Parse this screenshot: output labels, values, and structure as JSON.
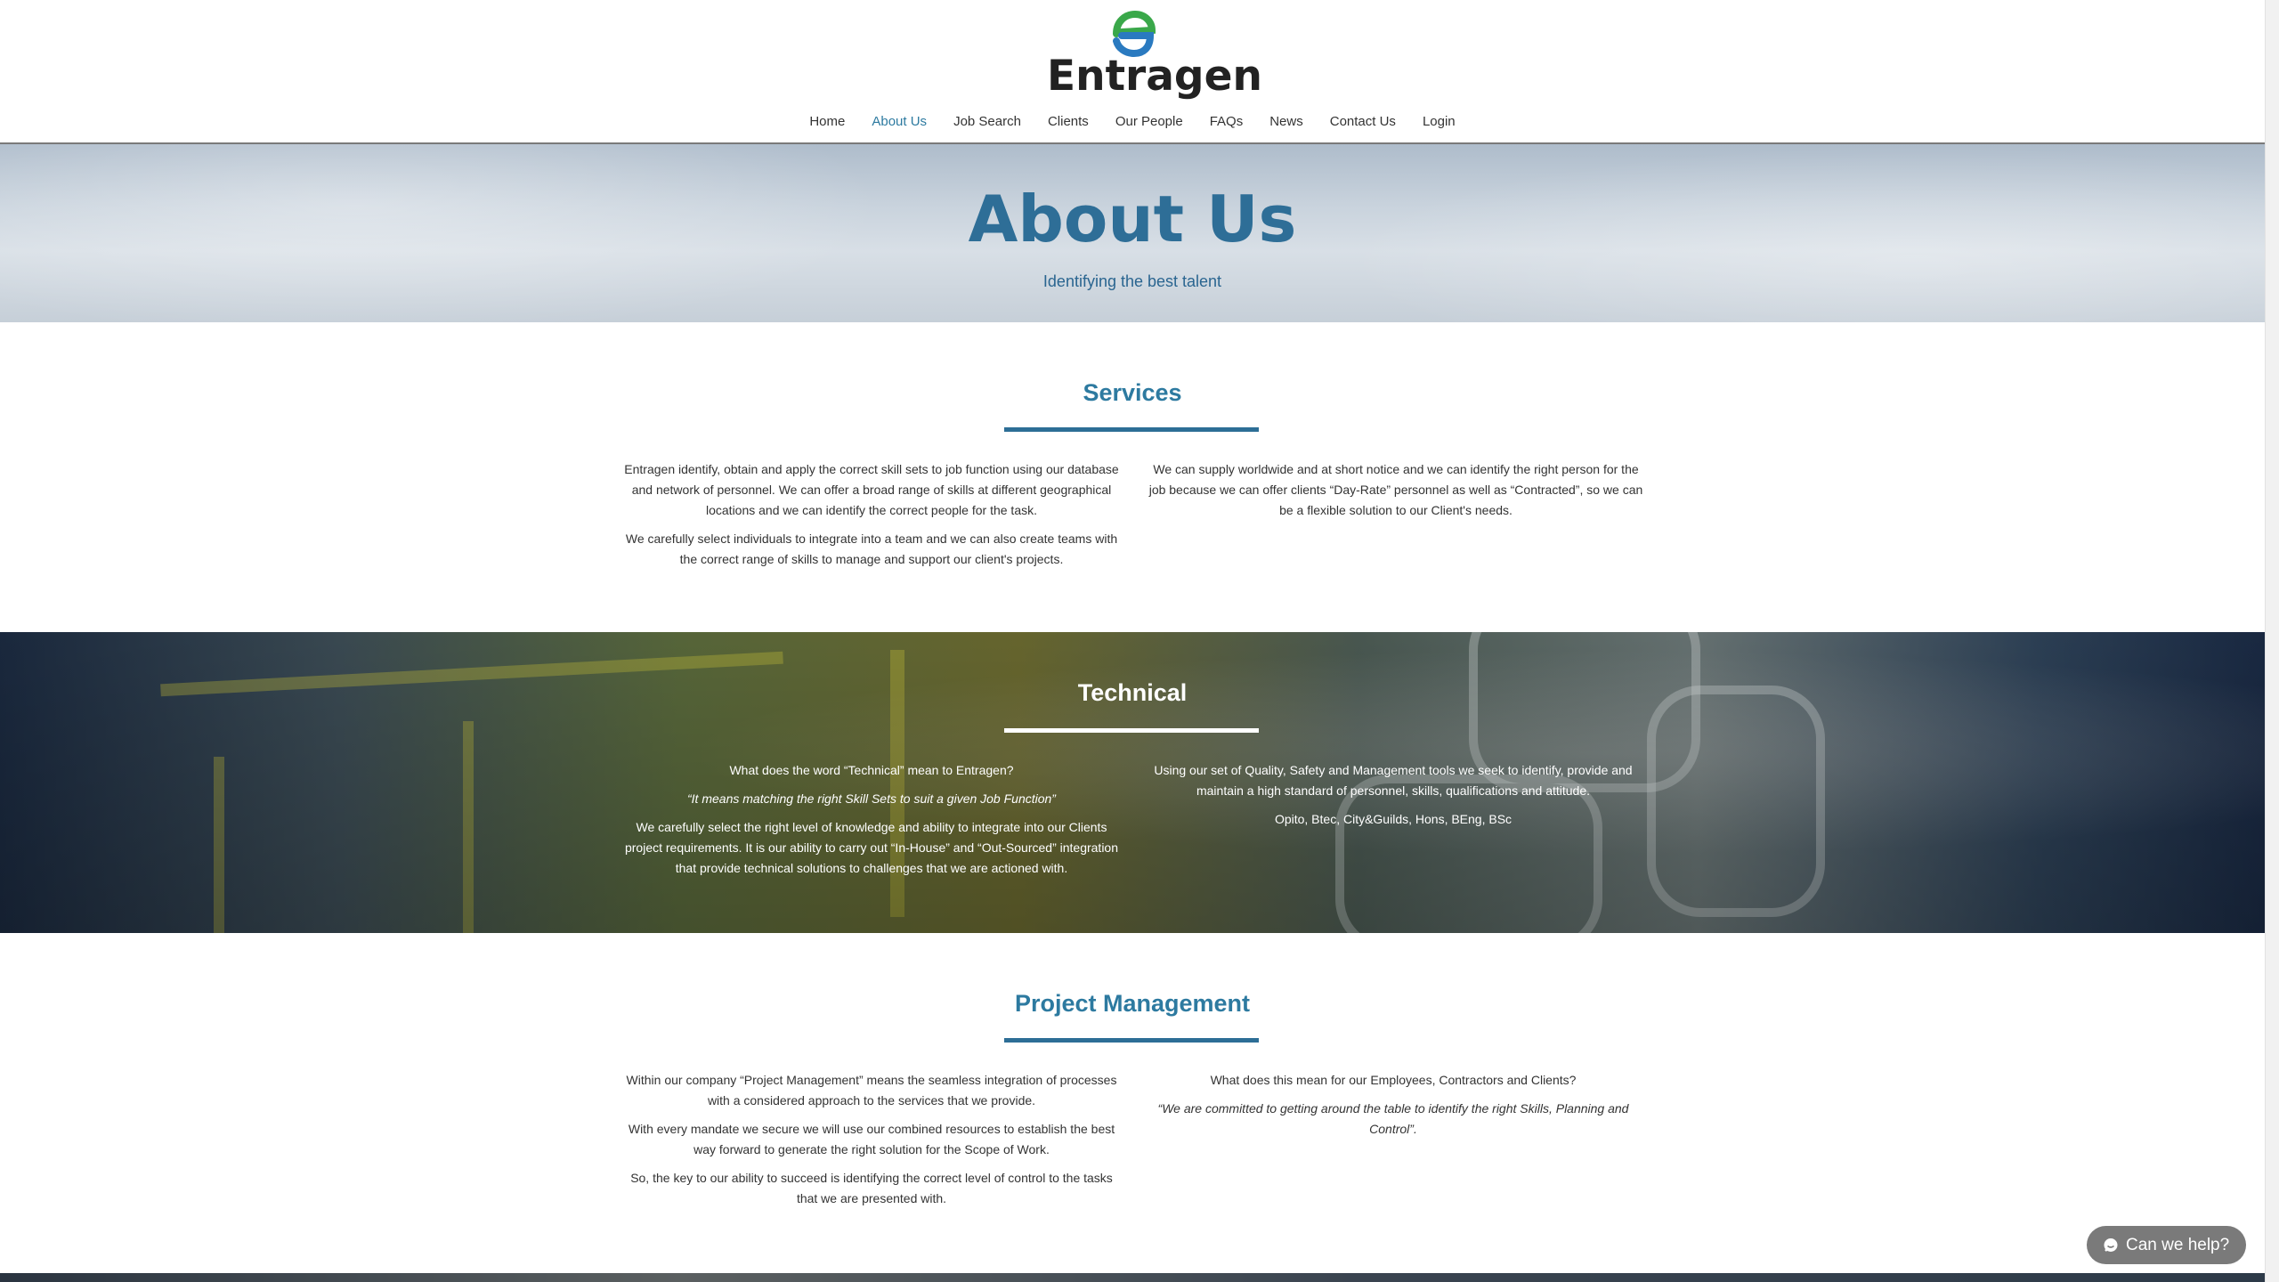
{
  "brand": {
    "name": "Entragen",
    "colors": {
      "primary": "#2d7aa0",
      "logo_green": "#3aa84a",
      "logo_blue": "#2a7ac0"
    }
  },
  "nav": {
    "items": [
      {
        "label": "Home"
      },
      {
        "label": "About Us",
        "active": true
      },
      {
        "label": "Job Search"
      },
      {
        "label": "Clients"
      },
      {
        "label": "Our People"
      },
      {
        "label": "FAQs"
      },
      {
        "label": "News"
      },
      {
        "label": "Contact Us"
      },
      {
        "label": "Login"
      }
    ]
  },
  "hero": {
    "title": "About Us",
    "subtitle": "Identifying the best talent"
  },
  "services": {
    "title": "Services",
    "left": [
      "Entragen identify, obtain and apply the correct skill sets to job function using our database and network of personnel. We can offer a broad range of skills at different geographical locations and we can identify the correct people for the task.",
      "We carefully select individuals to integrate into a team and we can also create teams with the correct range of skills to manage and support our client's projects."
    ],
    "right": [
      "We can supply worldwide and at short notice and we can identify the right person for the job because we can offer clients “Day-Rate” personnel as well as “Contracted”, so we can be a flexible solution to our Client's needs."
    ]
  },
  "technical": {
    "title": "Technical",
    "left": [
      "What does the word “Technical” mean to Entragen?",
      "“It means matching the right Skill Sets to suit a given Job Function”",
      "We carefully select the right level of knowledge and ability to integrate into our Clients project requirements. It is our ability to carry out “In-House” and “Out-Sourced” integration that provide technical solutions to challenges that we are actioned with."
    ],
    "right": [
      "Using our set of Quality, Safety and Management tools we seek to identify, provide and maintain a high standard of personnel, skills, qualifications and attitude.",
      "Opito, Btec, City&Guilds, Hons, BEng, BSc"
    ]
  },
  "project_management": {
    "title": "Project Management",
    "left": [
      "Within our company “Project Management” means the seamless integration of processes with a considered approach to the services that we provide.",
      "With every mandate we secure we will use our combined resources to establish the best way forward to generate the right solution for the Scope of Work.",
      "So, the key to our ability to succeed is identifying the correct level of control to the tasks that we are presented with."
    ],
    "right": [
      "What does this mean for our Employees, Contractors and Clients?",
      "“We are committed to getting around the table to identify the right Skills, Planning and Control”."
    ]
  },
  "chat": {
    "label": "Can we help?",
    "icon": "chat-bubble-icon"
  }
}
